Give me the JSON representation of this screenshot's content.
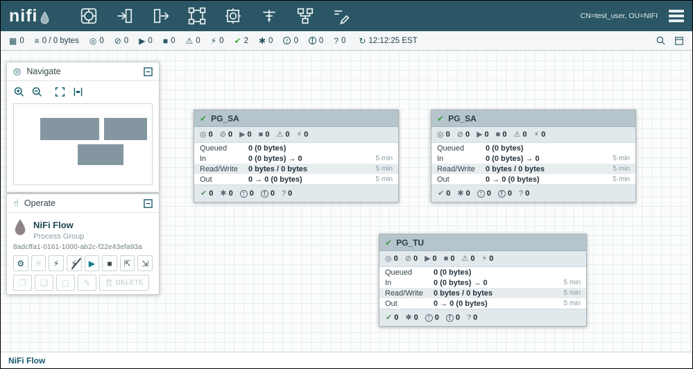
{
  "colors": {
    "header_bg": "#2a5665",
    "accent_teal": "#14505e",
    "pg_header_bg": "#b6c5cc",
    "success_green": "#3fa33f",
    "canvas_grid": "#eaeeef"
  },
  "header": {
    "brand": "nifi",
    "user_label": "CN=test_user, OU=NIFI",
    "toolbar_icons": [
      "processor",
      "input-port",
      "output-port",
      "process-group",
      "remote-process-group",
      "funnel",
      "template",
      "label"
    ]
  },
  "statusbar": {
    "items": [
      {
        "name": "active-threads",
        "glyph": "▦",
        "value": "0"
      },
      {
        "name": "total-queued",
        "glyph": "≡",
        "value": "0 / 0 bytes"
      },
      {
        "name": "transmitting",
        "glyph": "◎",
        "value": "0"
      },
      {
        "name": "not-transmitting",
        "glyph": "⊘",
        "value": "0"
      },
      {
        "name": "running",
        "glyph": "▶",
        "value": "0"
      },
      {
        "name": "stopped",
        "glyph": "■",
        "value": "0"
      },
      {
        "name": "invalid",
        "glyph": "⚠",
        "value": "0"
      },
      {
        "name": "disabled",
        "glyph": "⚡",
        "value": "0"
      },
      {
        "name": "up-to-date",
        "glyph": "✔",
        "value": "2"
      },
      {
        "name": "locally-modified",
        "glyph": "✱",
        "value": "0"
      },
      {
        "name": "stale",
        "glyph": "↑",
        "value": "0"
      },
      {
        "name": "locally-modified-and-stale",
        "glyph": "!",
        "value": "0"
      },
      {
        "name": "sync-failure",
        "glyph": "?",
        "value": "0"
      }
    ],
    "refresh_glyph": "↻",
    "refresh_time": "12:12:25 EST"
  },
  "navigate": {
    "title": "Navigate"
  },
  "operate": {
    "title": "Operate",
    "flow_name": "NiFi Flow",
    "flow_type": "Process Group",
    "flow_id": "8adcffa1-0161-1000-ab2c-f22e43efa93a",
    "buttons_row1": [
      {
        "name": "configuration",
        "glyph": "⚙"
      },
      {
        "name": "access-policies",
        "glyph": "✳"
      },
      {
        "name": "enable",
        "glyph": "⚡"
      },
      {
        "name": "disable",
        "glyph": "⚡"
      },
      {
        "name": "start",
        "glyph": "▶"
      },
      {
        "name": "stop",
        "glyph": "■"
      },
      {
        "name": "upload-template",
        "glyph": "⇱"
      },
      {
        "name": "create-template",
        "glyph": "⇲"
      }
    ],
    "buttons_row2": [
      {
        "name": "copy",
        "glyph": "❐"
      },
      {
        "name": "paste",
        "glyph": "❑"
      },
      {
        "name": "group",
        "glyph": "▢"
      },
      {
        "name": "fill-color",
        "glyph": "✎"
      }
    ],
    "delete_label": "DELETE"
  },
  "icons": {
    "transmitting": "◎",
    "not_transmitting": "⊘",
    "running": "▶",
    "stopped": "■",
    "invalid": "⚠",
    "disabled": "⚡",
    "up_to_date": "✔",
    "locally_modified": "✱",
    "stale": "↑",
    "locally_modified_stale": "!",
    "sync_failure": "?"
  },
  "process_groups": [
    {
      "name": "PG_SA",
      "stats_values": [
        "0",
        "0",
        "0",
        "0",
        "0",
        "0"
      ],
      "rows": [
        {
          "label": "Queued",
          "value": "0 (0 bytes)",
          "window": ""
        },
        {
          "label": "In",
          "value": "0 (0 bytes) → 0",
          "window": "5 min"
        },
        {
          "label": "Read/Write",
          "value": "0 bytes / 0 bytes",
          "window": "5 min"
        },
        {
          "label": "Out",
          "value": "0 → 0 (0 bytes)",
          "window": "5 min"
        }
      ],
      "footer_values": [
        "0",
        "0",
        "0",
        "0",
        "0"
      ]
    },
    {
      "name": "PG_SA",
      "stats_values": [
        "0",
        "0",
        "0",
        "0",
        "0",
        "0"
      ],
      "rows": [
        {
          "label": "Queued",
          "value": "0 (0 bytes)",
          "window": ""
        },
        {
          "label": "In",
          "value": "0 (0 bytes) → 0",
          "window": "5 min"
        },
        {
          "label": "Read/Write",
          "value": "0 bytes / 0 bytes",
          "window": "5 min"
        },
        {
          "label": "Out",
          "value": "0 → 0 (0 bytes)",
          "window": "5 min"
        }
      ],
      "footer_values": [
        "0",
        "0",
        "0",
        "0",
        "0"
      ]
    },
    {
      "name": "PG_TU",
      "stats_values": [
        "0",
        "0",
        "0",
        "0",
        "0",
        "0"
      ],
      "rows": [
        {
          "label": "Queued",
          "value": "0 (0 bytes)",
          "window": ""
        },
        {
          "label": "In",
          "value": "0 (0 bytes) → 0",
          "window": "5 min"
        },
        {
          "label": "Read/Write",
          "value": "0 bytes / 0 bytes",
          "window": "5 min"
        },
        {
          "label": "Out",
          "value": "0 → 0 (0 bytes)",
          "window": "5 min"
        }
      ],
      "footer_values": [
        "0",
        "0",
        "0",
        "0",
        "0"
      ]
    }
  ],
  "breadcrumb": {
    "root": "NiFi Flow"
  }
}
